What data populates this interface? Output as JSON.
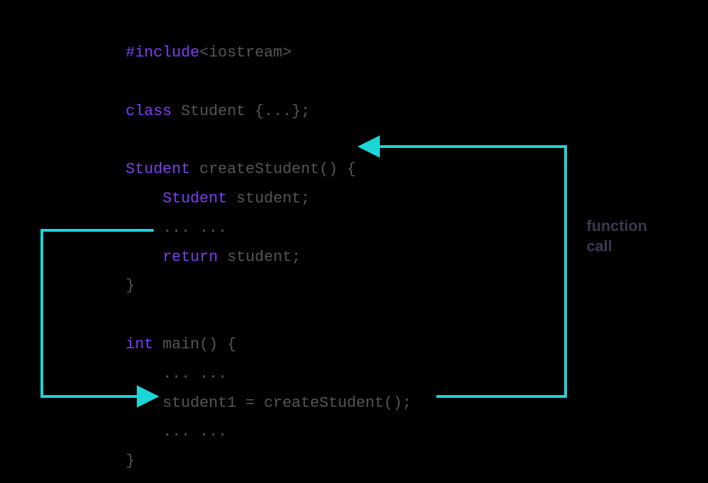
{
  "code": {
    "line1": {
      "include": "#include",
      "header": "<iostream>"
    },
    "line2": {
      "kw": "class",
      "rest": " Student {...};"
    },
    "line3": {
      "type": "Student",
      "rest": " createStudent() {"
    },
    "line4": {
      "type": "Student",
      "rest": " student;"
    },
    "line5": {
      "dots": "... ..."
    },
    "line6": {
      "kw": "return",
      "rest": " student;"
    },
    "line7": {
      "brace": "}"
    },
    "line8": {
      "kw": "int",
      "rest": " main() {"
    },
    "line9": {
      "dots": "... ..."
    },
    "line10": {
      "stmt": "student1 = createStudent();"
    },
    "line11": {
      "dots": "... ..."
    },
    "line12": {
      "brace": "}"
    }
  },
  "annotation": {
    "label_line1": "function",
    "label_line2": "call"
  },
  "colors": {
    "arrow": "#1ad6d6",
    "keyword": "#7b3ff2",
    "ident": "#555555",
    "annotation": "#383850"
  }
}
